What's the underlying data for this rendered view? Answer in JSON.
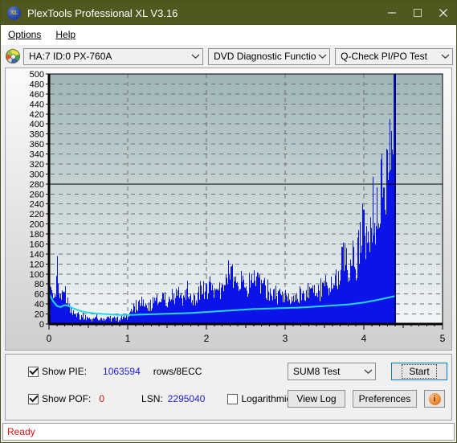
{
  "window": {
    "title": "PlexTools Professional XL V3.16",
    "app_icon": "xl-logo-icon",
    "minimize_label": "Minimize",
    "maximize_label": "Maximize",
    "close_label": "Close",
    "titlebar_color": "#50571f"
  },
  "menubar": {
    "items": [
      {
        "label": "Options",
        "accel": "O"
      },
      {
        "label": "Help",
        "accel": "H"
      }
    ]
  },
  "toolbar": {
    "drive_icon": "optical-disc-icon",
    "drive_select": "HA:7 ID:0  PX-760A",
    "function_select": "DVD Diagnostic Functions",
    "test_select": "Q-Check PI/PO Test"
  },
  "controls": {
    "show_pie_label": "Show PIE:",
    "show_pie_checked": true,
    "pie_value": "1063594",
    "pie_unit": "rows/8ECC",
    "show_pof_label": "Show POF:",
    "show_pof_checked": true,
    "pof_value": "0",
    "lsn_label": "LSN:",
    "lsn_value": "2295040",
    "logarithmic_label": "Logarithmic",
    "logarithmic_checked": false,
    "sum_select": "SUM8 Test",
    "start_button": "Start",
    "view_log_button": "View Log",
    "preferences_button": "Preferences",
    "info_button": "i"
  },
  "statusbar": {
    "text": "Ready"
  },
  "chart_data": {
    "type": "area",
    "title": "",
    "xlabel": "",
    "ylabel": "",
    "xlim": [
      0,
      5
    ],
    "ylim": [
      0,
      500
    ],
    "ytick_step": 20,
    "xticks": [
      0,
      1,
      2,
      3,
      4,
      5
    ],
    "xtick_labels": [
      "0",
      "1",
      "2",
      "3",
      "4",
      "5"
    ],
    "yticks": [
      0,
      20,
      40,
      60,
      80,
      100,
      120,
      140,
      160,
      180,
      200,
      220,
      240,
      260,
      280,
      300,
      320,
      340,
      360,
      380,
      400,
      420,
      440,
      460,
      480,
      500
    ],
    "ytick_labels": [
      "0",
      "20",
      "40",
      "60",
      "80",
      "100",
      "120",
      "140",
      "160",
      "180",
      "200",
      "220",
      "240",
      "260",
      "280",
      "300",
      "320",
      "340",
      "360",
      "380",
      "400",
      "420",
      "440",
      "460",
      "480",
      "500"
    ],
    "grid": true,
    "legend": "none",
    "threshold_line": 280,
    "data_end_x": 4.4,
    "colors": {
      "bars": "#0a14e8",
      "average_line": "#26d6ee",
      "plot_top": "#9fb5b7",
      "plot_bottom": "#f2f6f7",
      "threshold": "#000000",
      "grid": "#707070"
    },
    "series": [
      {
        "name": "PIE",
        "type": "bar",
        "x": [
          0.0,
          0.02,
          0.04,
          0.06,
          0.08,
          0.1,
          0.12,
          0.14,
          0.16,
          0.18,
          0.2,
          0.22,
          0.24,
          0.26,
          0.28,
          0.3,
          0.32,
          0.34,
          0.36,
          0.38,
          0.4,
          0.42,
          0.44,
          0.46,
          0.48,
          0.5,
          0.55,
          0.6,
          0.65,
          0.7,
          0.75,
          0.8,
          0.85,
          0.9,
          0.95,
          1.0,
          1.05,
          1.1,
          1.15,
          1.2,
          1.25,
          1.3,
          1.35,
          1.4,
          1.45,
          1.5,
          1.55,
          1.6,
          1.65,
          1.7,
          1.75,
          1.8,
          1.85,
          1.9,
          1.95,
          2.0,
          2.05,
          2.1,
          2.15,
          2.2,
          2.25,
          2.3,
          2.35,
          2.4,
          2.45,
          2.5,
          2.55,
          2.6,
          2.65,
          2.7,
          2.75,
          2.8,
          2.85,
          2.9,
          2.95,
          3.0,
          3.05,
          3.1,
          3.15,
          3.2,
          3.25,
          3.3,
          3.35,
          3.4,
          3.45,
          3.5,
          3.55,
          3.6,
          3.65,
          3.7,
          3.75,
          3.8,
          3.85,
          3.9,
          3.95,
          4.0,
          4.05,
          4.1,
          4.15,
          4.2,
          4.25,
          4.3,
          4.33,
          4.36,
          4.38,
          4.4
        ],
        "values": [
          78,
          74,
          62,
          55,
          70,
          110,
          66,
          48,
          80,
          74,
          60,
          44,
          36,
          30,
          26,
          22,
          20,
          18,
          22,
          17,
          15,
          14,
          13,
          15,
          12,
          12,
          13,
          16,
          12,
          11,
          14,
          12,
          10,
          12,
          11,
          14,
          28,
          36,
          40,
          38,
          44,
          42,
          50,
          46,
          52,
          44,
          58,
          56,
          62,
          52,
          66,
          54,
          48,
          64,
          72,
          62,
          80,
          76,
          64,
          72,
          98,
          104,
          84,
          76,
          88,
          74,
          80,
          90,
          86,
          74,
          70,
          66,
          62,
          58,
          56,
          50,
          52,
          48,
          56,
          60,
          54,
          62,
          66,
          58,
          70,
          74,
          66,
          78,
          90,
          118,
          130,
          104,
          150,
          118,
          172,
          200,
          148,
          240,
          210,
          260,
          290,
          300,
          340,
          420,
          470,
          485
        ]
      },
      {
        "name": "PIE Average",
        "type": "line",
        "x": [
          0.0,
          0.05,
          0.1,
          0.15,
          0.2,
          0.25,
          0.3,
          0.35,
          0.4,
          0.45,
          0.5,
          0.6,
          0.7,
          0.8,
          0.9,
          1.0,
          1.2,
          1.4,
          1.6,
          1.8,
          2.0,
          2.2,
          2.4,
          2.6,
          2.8,
          3.0,
          3.2,
          3.4,
          3.6,
          3.8,
          4.0,
          4.2,
          4.4
        ],
        "values": [
          62,
          46,
          36,
          34,
          38,
          36,
          32,
          29,
          26,
          24,
          23,
          21,
          20,
          19,
          18,
          18,
          19,
          20,
          21,
          22,
          24,
          26,
          28,
          30,
          31,
          32,
          33,
          35,
          37,
          39,
          43,
          49,
          56
        ]
      }
    ]
  }
}
